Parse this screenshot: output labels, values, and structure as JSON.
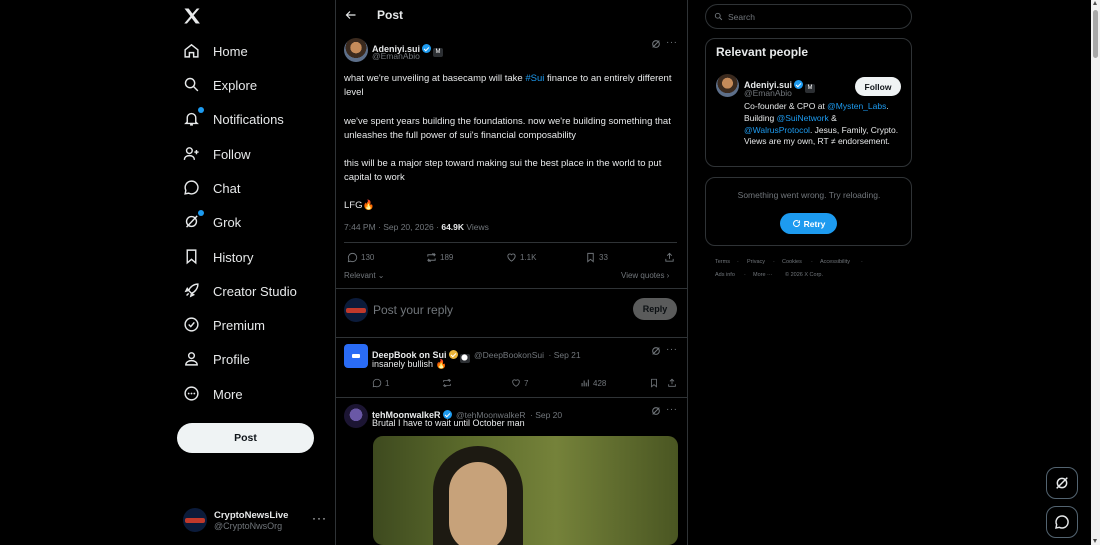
{
  "nav": {
    "items": [
      {
        "label": "Home",
        "icon": "home-icon"
      },
      {
        "label": "Explore",
        "icon": "search-icon"
      },
      {
        "label": "Notifications",
        "icon": "bell-icon"
      },
      {
        "label": "Follow",
        "icon": "person-plus-icon"
      },
      {
        "label": "Chat",
        "icon": "chat-icon"
      },
      {
        "label": "Grok",
        "icon": "grok-icon"
      },
      {
        "label": "History",
        "icon": "bookmark-icon"
      },
      {
        "label": "Creator Studio",
        "icon": "rocket-icon"
      },
      {
        "label": "Premium",
        "icon": "verified-icon"
      },
      {
        "label": "Profile",
        "icon": "person-icon"
      },
      {
        "label": "More",
        "icon": "more-circle-icon"
      }
    ],
    "post_label": "Post",
    "account": {
      "name": "CryptoNewsLive",
      "handle": "@CryptoNwsOrg"
    }
  },
  "header": {
    "title": "Post"
  },
  "main_post": {
    "author": "Adeniyi.sui",
    "handle": "@EmanAbio",
    "paragraphs": [
      {
        "before": "what we're unveiling at basecamp will take ",
        "hashtag": "#Sui",
        "after": " finance to an entirely different level"
      },
      {
        "text": "we've spent years building the foundations. now we're building something that unleashes the full power of sui's financial composability"
      },
      {
        "text": "this will be a major step toward making sui the best place in the world to put capital to work"
      },
      {
        "text": "LFG🔥"
      }
    ],
    "time": "7:44 PM · Sep 20, 2026 · ",
    "views": "64.9K",
    "views_label": " Views",
    "stats": {
      "replies": "130",
      "reposts": "189",
      "likes": "1.1K",
      "bookmarks": "33"
    },
    "relevant_label": "Relevant",
    "view_quotes_label": "View quotes"
  },
  "reply_box": {
    "placeholder": "Post your reply",
    "button": "Reply"
  },
  "replies": [
    {
      "name": "DeepBook on Sui",
      "handle": "@DeepBookonSui",
      "date": "· Sep 21",
      "text": "insanely bullish 🔥",
      "stats": {
        "replies": "1",
        "reposts": "",
        "likes": "7",
        "views": "428"
      }
    },
    {
      "name": "tehMoonwalkeR",
      "handle": "@tehMoonwalkeR",
      "date": "· Sep 20",
      "text": "Brutal I have to wait until October man"
    }
  ],
  "search": {
    "placeholder": "Search"
  },
  "relevant_people": {
    "title": "Relevant people",
    "name": "Adeniyi.sui",
    "handle": "@EmanAbio",
    "follow_label": "Follow",
    "bio": {
      "p1": "Co-founder & CPO at ",
      "m1": "@Mysten_Labs",
      "p2": ". Building ",
      "m2": "@SuiNetwork",
      "p3": " & ",
      "m3": "@WalrusProtocol",
      "p4": ". Jesus, Family, Crypto. Views are my own, RT ≠ endorsement."
    }
  },
  "error_card": {
    "message": "Something went wrong. Try reloading.",
    "retry_label": "Retry"
  },
  "footer": {
    "row1": [
      "Terms",
      "Privacy",
      "Cookies",
      "Accessibility"
    ],
    "row2": [
      "Ads info",
      "More ···",
      "© 2026 X Corp."
    ]
  },
  "colors": {
    "accent": "#1d9bf0",
    "background": "#000000",
    "border": "#2f3336",
    "muted": "#71767b"
  }
}
